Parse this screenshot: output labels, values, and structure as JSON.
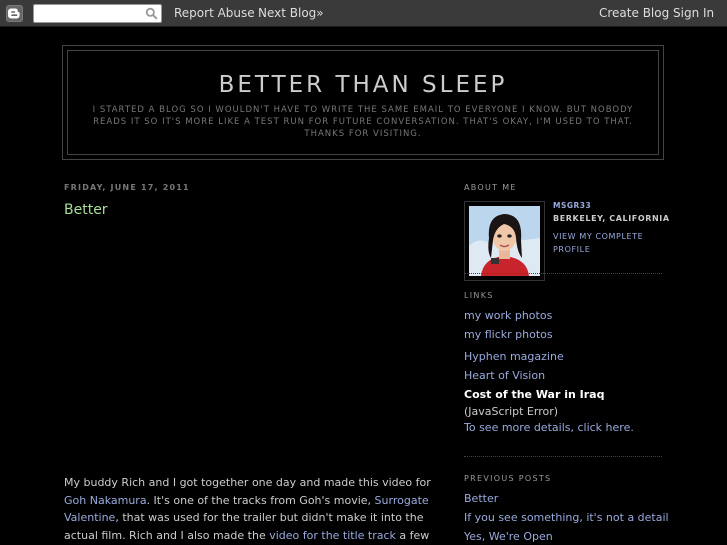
{
  "navbar": {
    "search_value": "",
    "report_abuse": "Report Abuse",
    "next_blog": "Next Blog»",
    "create_blog": "Create Blog",
    "sign_in": "Sign In"
  },
  "header": {
    "title": "BETTER THAN SLEEP",
    "description": "I started a blog so I wouldn't have to write the same email to everyone I know. But nobody reads it so it's more like a test run for future conversation. That's okay, I'm used to that. Thanks for visiting."
  },
  "post": {
    "date": "FRIDAY, JUNE 17, 2011",
    "title": "Better",
    "body": {
      "t1": "My buddy Rich and I got together one day and made this video for ",
      "link1": "Goh Nakamura",
      "t2": ". It's one of the tracks from Goh's movie, ",
      "link2": "Surrogate Valentine",
      "t3": ", that was used for the trailer but didn't make it into the actual film. Rich and I also made the ",
      "link3": "video for the title track",
      "t4": " a few months ago. Musicians, befriend us,"
    }
  },
  "sidebar": {
    "about_heading": "ABOUT ME",
    "profile_name": "MSGR33",
    "profile_location": "BERKELEY, CALIFORNIA",
    "profile_link": "VIEW MY COMPLETE PROFILE",
    "links_heading": "LINKS",
    "links": [
      "my work photos",
      "my flickr photos",
      "Hyphen magazine",
      "Heart of Vision"
    ],
    "widget_title": "Cost of the War in Iraq",
    "widget_error": "(JavaScript Error)",
    "widget_details": "To see more details, click here.",
    "previous_heading": "PREVIOUS POSTS",
    "previous_posts": [
      "Better",
      "If you see something, it's not a detail",
      "Yes, We're Open"
    ]
  },
  "colors": {
    "background": "#000000",
    "navbar": "#3a3a3a",
    "text": "#cccccc",
    "link": "#99aadd",
    "post_title": "#aadd99"
  }
}
